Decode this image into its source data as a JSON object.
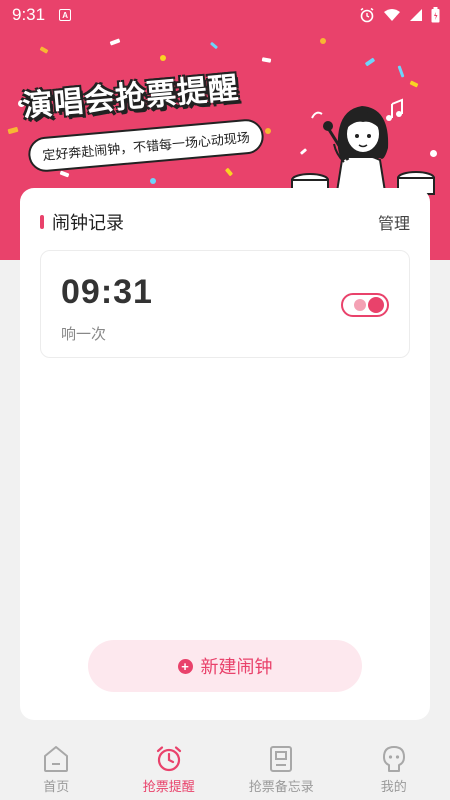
{
  "status_bar": {
    "time": "9:31",
    "notification_icon": "a-notification-icon",
    "icons": [
      "alarm-icon",
      "wifi-icon",
      "signal-icon",
      "battery-icon"
    ]
  },
  "header": {
    "title": "演唱会抢票提醒",
    "subtitle": "定好奔赴闹钟，不错每一场心动现场",
    "accent_color": "#e9426b"
  },
  "section": {
    "title": "闹钟记录",
    "manage_label": "管理"
  },
  "alarms": [
    {
      "time": "09:31",
      "repeat": "响一次",
      "enabled": true
    }
  ],
  "actions": {
    "new_alarm_label": "新建闹钟"
  },
  "nav": {
    "items": [
      {
        "label": "首页",
        "icon": "home-icon",
        "active": false
      },
      {
        "label": "抢票提醒",
        "icon": "alarm-clock-icon",
        "active": true
      },
      {
        "label": "抢票备忘录",
        "icon": "memo-icon",
        "active": false
      },
      {
        "label": "我的",
        "icon": "profile-icon",
        "active": false
      }
    ]
  }
}
